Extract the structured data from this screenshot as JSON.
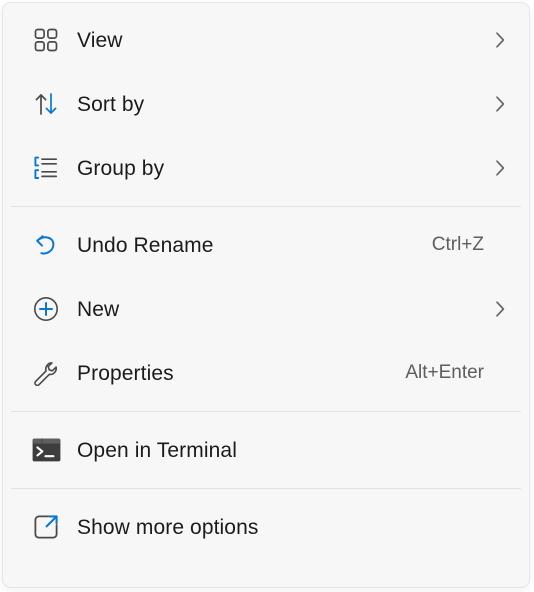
{
  "menu": {
    "title": "Windows 11 desktop context menu",
    "background_color": "#f7f7f7",
    "accent_color": "#0b78d0",
    "text_color": "#1b1b1b",
    "shortcut_color": "#5e5e5e",
    "separator_color": "#e2e2e2",
    "groups": [
      {
        "name": "view-group",
        "items": [
          {
            "id": "view",
            "label": "View",
            "icon": "grid-2x2-icon",
            "shortcut": "",
            "submenu": true
          },
          {
            "id": "sort-by",
            "label": "Sort by",
            "icon": "sort-arrows-icon",
            "shortcut": "",
            "submenu": true
          },
          {
            "id": "group-by",
            "label": "Group by",
            "icon": "group-list-icon",
            "shortcut": "",
            "submenu": true
          }
        ]
      },
      {
        "name": "actions-group",
        "items": [
          {
            "id": "undo-rename",
            "label": "Undo Rename",
            "icon": "undo-arrow-icon",
            "shortcut": "Ctrl+Z",
            "submenu": false
          },
          {
            "id": "new",
            "label": "New",
            "icon": "plus-circle-icon",
            "shortcut": "",
            "submenu": true
          },
          {
            "id": "properties",
            "label": "Properties",
            "icon": "wrench-icon",
            "shortcut": "Alt+Enter",
            "submenu": false
          }
        ]
      },
      {
        "name": "terminal-group",
        "items": [
          {
            "id": "open-in-terminal",
            "label": "Open in Terminal",
            "icon": "terminal-icon",
            "shortcut": "",
            "submenu": false
          }
        ]
      },
      {
        "name": "more-group",
        "items": [
          {
            "id": "show-more-options",
            "label": "Show more options",
            "icon": "open-external-icon",
            "shortcut": "",
            "submenu": false
          }
        ]
      }
    ]
  }
}
